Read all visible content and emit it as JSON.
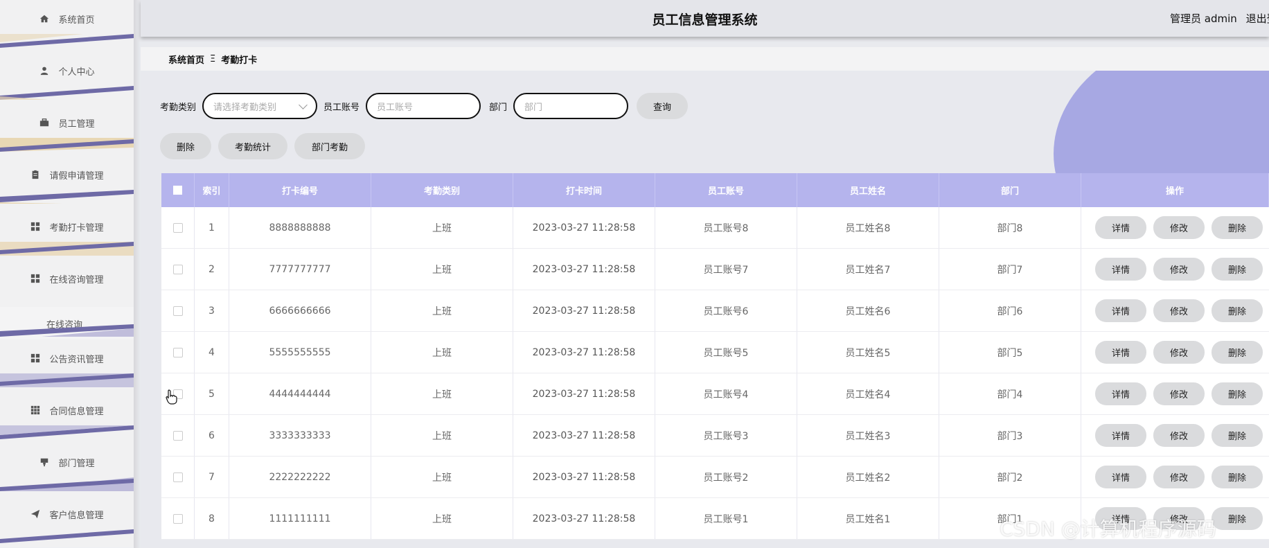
{
  "sidebar": {
    "items": [
      {
        "label": "系统首页",
        "icon": "home-icon"
      },
      {
        "label": "个人中心",
        "icon": "user-icon"
      },
      {
        "label": "员工管理",
        "icon": "briefcase-icon"
      },
      {
        "label": "请假申请管理",
        "icon": "clipboard-icon"
      },
      {
        "label": "考勤打卡管理",
        "icon": "grid-icon"
      },
      {
        "label": "在线咨询管理",
        "icon": "grid-icon"
      },
      {
        "label": "在线咨询",
        "icon": ""
      },
      {
        "label": "公告资讯管理",
        "icon": "grid-icon"
      },
      {
        "label": "合同信息管理",
        "icon": "apps-icon"
      },
      {
        "label": "部门管理",
        "icon": "pin-icon"
      },
      {
        "label": "客户信息管理",
        "icon": "send-icon"
      }
    ]
  },
  "header": {
    "title": "员工信息管理系统",
    "role": "管理员",
    "username": "admin",
    "logout": "退出登录"
  },
  "breadcrumb": {
    "home": "系统首页",
    "separator": "Ξ",
    "current": "考勤打卡"
  },
  "search": {
    "type_label": "考勤类别",
    "type_placeholder": "请选择考勤类别",
    "account_label": "员工账号",
    "account_placeholder": "员工账号",
    "dept_label": "部门",
    "dept_placeholder": "部门",
    "search_button": "查询"
  },
  "actions": {
    "delete": "删除",
    "stats": "考勤统计",
    "dept_attendance": "部门考勤"
  },
  "table": {
    "headers": [
      "索引",
      "打卡编号",
      "考勤类别",
      "打卡时间",
      "员工账号",
      "员工姓名",
      "部门",
      "操作"
    ],
    "ops": {
      "detail": "详情",
      "edit": "修改",
      "delete": "删除"
    },
    "rows": [
      {
        "idx": "1",
        "no": "8888888888",
        "type": "上班",
        "time": "2023-03-27 11:28:58",
        "acct": "员工账号8",
        "name": "员工姓名8",
        "dept": "部门8"
      },
      {
        "idx": "2",
        "no": "7777777777",
        "type": "上班",
        "time": "2023-03-27 11:28:58",
        "acct": "员工账号7",
        "name": "员工姓名7",
        "dept": "部门7"
      },
      {
        "idx": "3",
        "no": "6666666666",
        "type": "上班",
        "time": "2023-03-27 11:28:58",
        "acct": "员工账号6",
        "name": "员工姓名6",
        "dept": "部门6"
      },
      {
        "idx": "4",
        "no": "5555555555",
        "type": "上班",
        "time": "2023-03-27 11:28:58",
        "acct": "员工账号5",
        "name": "员工姓名5",
        "dept": "部门5"
      },
      {
        "idx": "5",
        "no": "4444444444",
        "type": "上班",
        "time": "2023-03-27 11:28:58",
        "acct": "员工账号4",
        "name": "员工姓名4",
        "dept": "部门4"
      },
      {
        "idx": "6",
        "no": "3333333333",
        "type": "上班",
        "time": "2023-03-27 11:28:58",
        "acct": "员工账号3",
        "name": "员工姓名3",
        "dept": "部门3"
      },
      {
        "idx": "7",
        "no": "2222222222",
        "type": "上班",
        "time": "2023-03-27 11:28:58",
        "acct": "员工账号2",
        "name": "员工姓名2",
        "dept": "部门2"
      },
      {
        "idx": "8",
        "no": "1111111111",
        "type": "上班",
        "time": "2023-03-27 11:28:58",
        "acct": "员工账号1",
        "name": "员工姓名1",
        "dept": "部门1"
      }
    ]
  },
  "watermark": "CSDN @计算机程序源码",
  "colors": {
    "table_header": "#b5b4ed",
    "accent_blob": "#a7a8e3",
    "stripe_dark": "#6e6aa6",
    "stripe_tan": "#e8d7b4"
  }
}
